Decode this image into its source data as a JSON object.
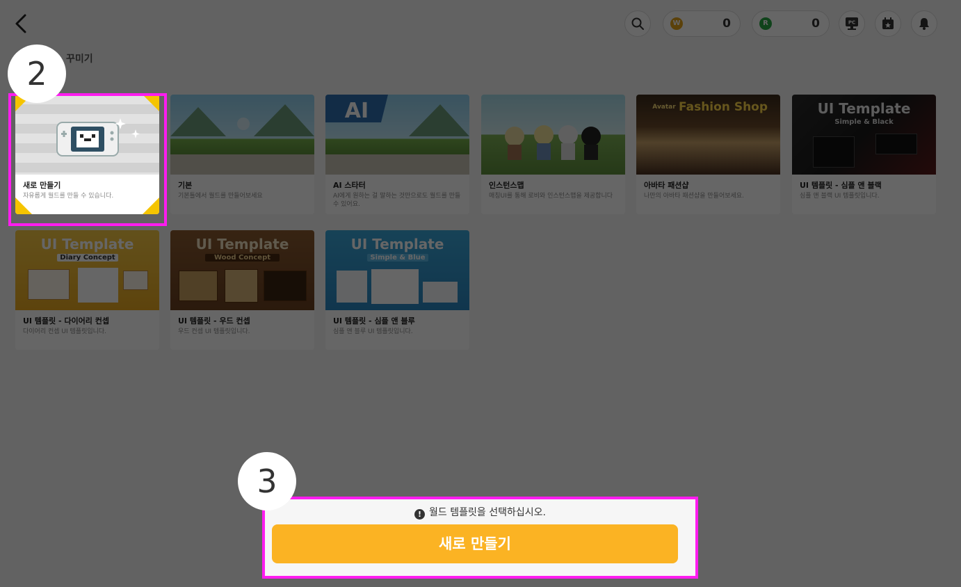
{
  "header": {
    "back_icon": "chevron-left-icon",
    "search_icon": "search-icon",
    "currencies": [
      {
        "symbol": "W",
        "value": "0",
        "color": "#e3a21a"
      },
      {
        "symbol": "R",
        "value": "0",
        "color": "#28a745"
      }
    ],
    "pc_label": "PC",
    "calendar_icon": "calendar-icon",
    "bell_icon": "bell-icon"
  },
  "section_title": "꾸미기",
  "cards": [
    {
      "title": "새로 만들기",
      "desc": "자유롭게 월드를 만들 수 있습니다.",
      "selected": true
    },
    {
      "title": "기본",
      "desc": "기본틀에서 월드를 만들어보세요"
    },
    {
      "title": "AI 스타터",
      "desc": "AI에게 원하는 걸 말하는 것만으로도 월드를 만들 수 있어요.",
      "thumb_text": "AI"
    },
    {
      "title": "인스턴스맵",
      "desc": "매칭UI를 통해 로비와 인스턴스맵을 제공합니다"
    },
    {
      "title": "아바타 패션샵",
      "desc": "나만의 아바타 패션샵을 만들어보세요.",
      "thumb_text": "Fashion Shop",
      "thumb_sub": "Avatar"
    },
    {
      "title": "UI 템플릿 - 심플 앤 블랙",
      "desc": "심플 앤 블랙 UI 템플릿입니다.",
      "thumb_text": "UI Template",
      "thumb_sub": "Simple & Black"
    },
    {
      "title": "UI 템플릿 - 다이어리 컨셉",
      "desc": "다이어리 컨셉 UI 템플릿입니다.",
      "thumb_text": "UI Template",
      "thumb_sub": "Diary Concept"
    },
    {
      "title": "UI 템플릿 - 우드 컨셉",
      "desc": "우드 컨셉 UI 템플릿입니다.",
      "thumb_text": "UI Template",
      "thumb_sub": "Wood Concept"
    },
    {
      "title": "UI 템플릿 - 심플 앤 블루",
      "desc": "심플 앤 블루 UI 템플릿입니다.",
      "thumb_text": "UI Template",
      "thumb_sub": "Simple & Blue"
    }
  ],
  "steps": {
    "step2": "2",
    "step3": "3"
  },
  "bottom": {
    "notice_icon": "!",
    "notice": "월드 템플릿을 선택하십시오.",
    "create_button": "새로 만들기"
  },
  "colors": {
    "highlight": "#ff1cf0",
    "accent": "#fbb323"
  }
}
